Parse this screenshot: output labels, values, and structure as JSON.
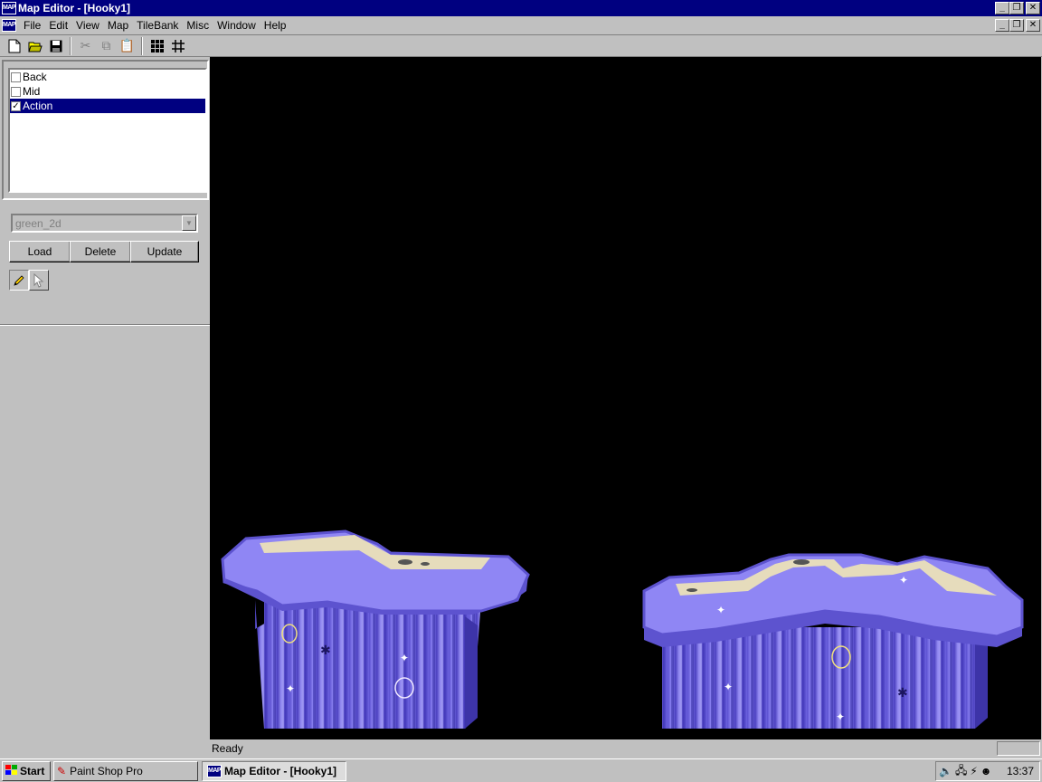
{
  "window": {
    "title": "Map Editor - [Hooky1]",
    "app_icon": "map-editor-icon",
    "app_icon_text": "MAP"
  },
  "menu": {
    "items": [
      "File",
      "Edit",
      "View",
      "Map",
      "TileBank",
      "Misc",
      "Window",
      "Help"
    ]
  },
  "toolbar": {
    "buttons": [
      {
        "icon": "new-document-icon",
        "enabled": true
      },
      {
        "icon": "open-folder-icon",
        "enabled": true
      },
      {
        "icon": "save-icon",
        "enabled": true
      },
      {
        "icon": "cut-icon",
        "enabled": false
      },
      {
        "icon": "copy-icon",
        "enabled": false
      },
      {
        "icon": "paste-icon",
        "enabled": false
      },
      {
        "icon": "tile-grid-icon",
        "enabled": true
      },
      {
        "icon": "grid-lines-icon",
        "enabled": true
      }
    ]
  },
  "layers": [
    {
      "label": "Back",
      "checked": false,
      "selected": false
    },
    {
      "label": "Mid",
      "checked": false,
      "selected": false
    },
    {
      "label": "Action",
      "checked": true,
      "selected": true
    }
  ],
  "tilebank": {
    "selected": "green_2d",
    "buttons": {
      "load": "Load",
      "delete": "Delete",
      "update": "Update"
    }
  },
  "tools": [
    {
      "icon": "pencil-icon",
      "active": true
    },
    {
      "icon": "pointer-arrow-icon",
      "active": false
    }
  ],
  "status": {
    "text": "Ready"
  },
  "taskbar": {
    "start": "Start",
    "tasks": [
      "Paint Shop Pro",
      "Map Editor - [Hooky1]"
    ],
    "clock": "13:37"
  },
  "colors": {
    "title_bar": "#000080",
    "canvas_bg": "#000000",
    "platform_purple": "#8a7cf0",
    "sand": "#e6dcbc"
  }
}
